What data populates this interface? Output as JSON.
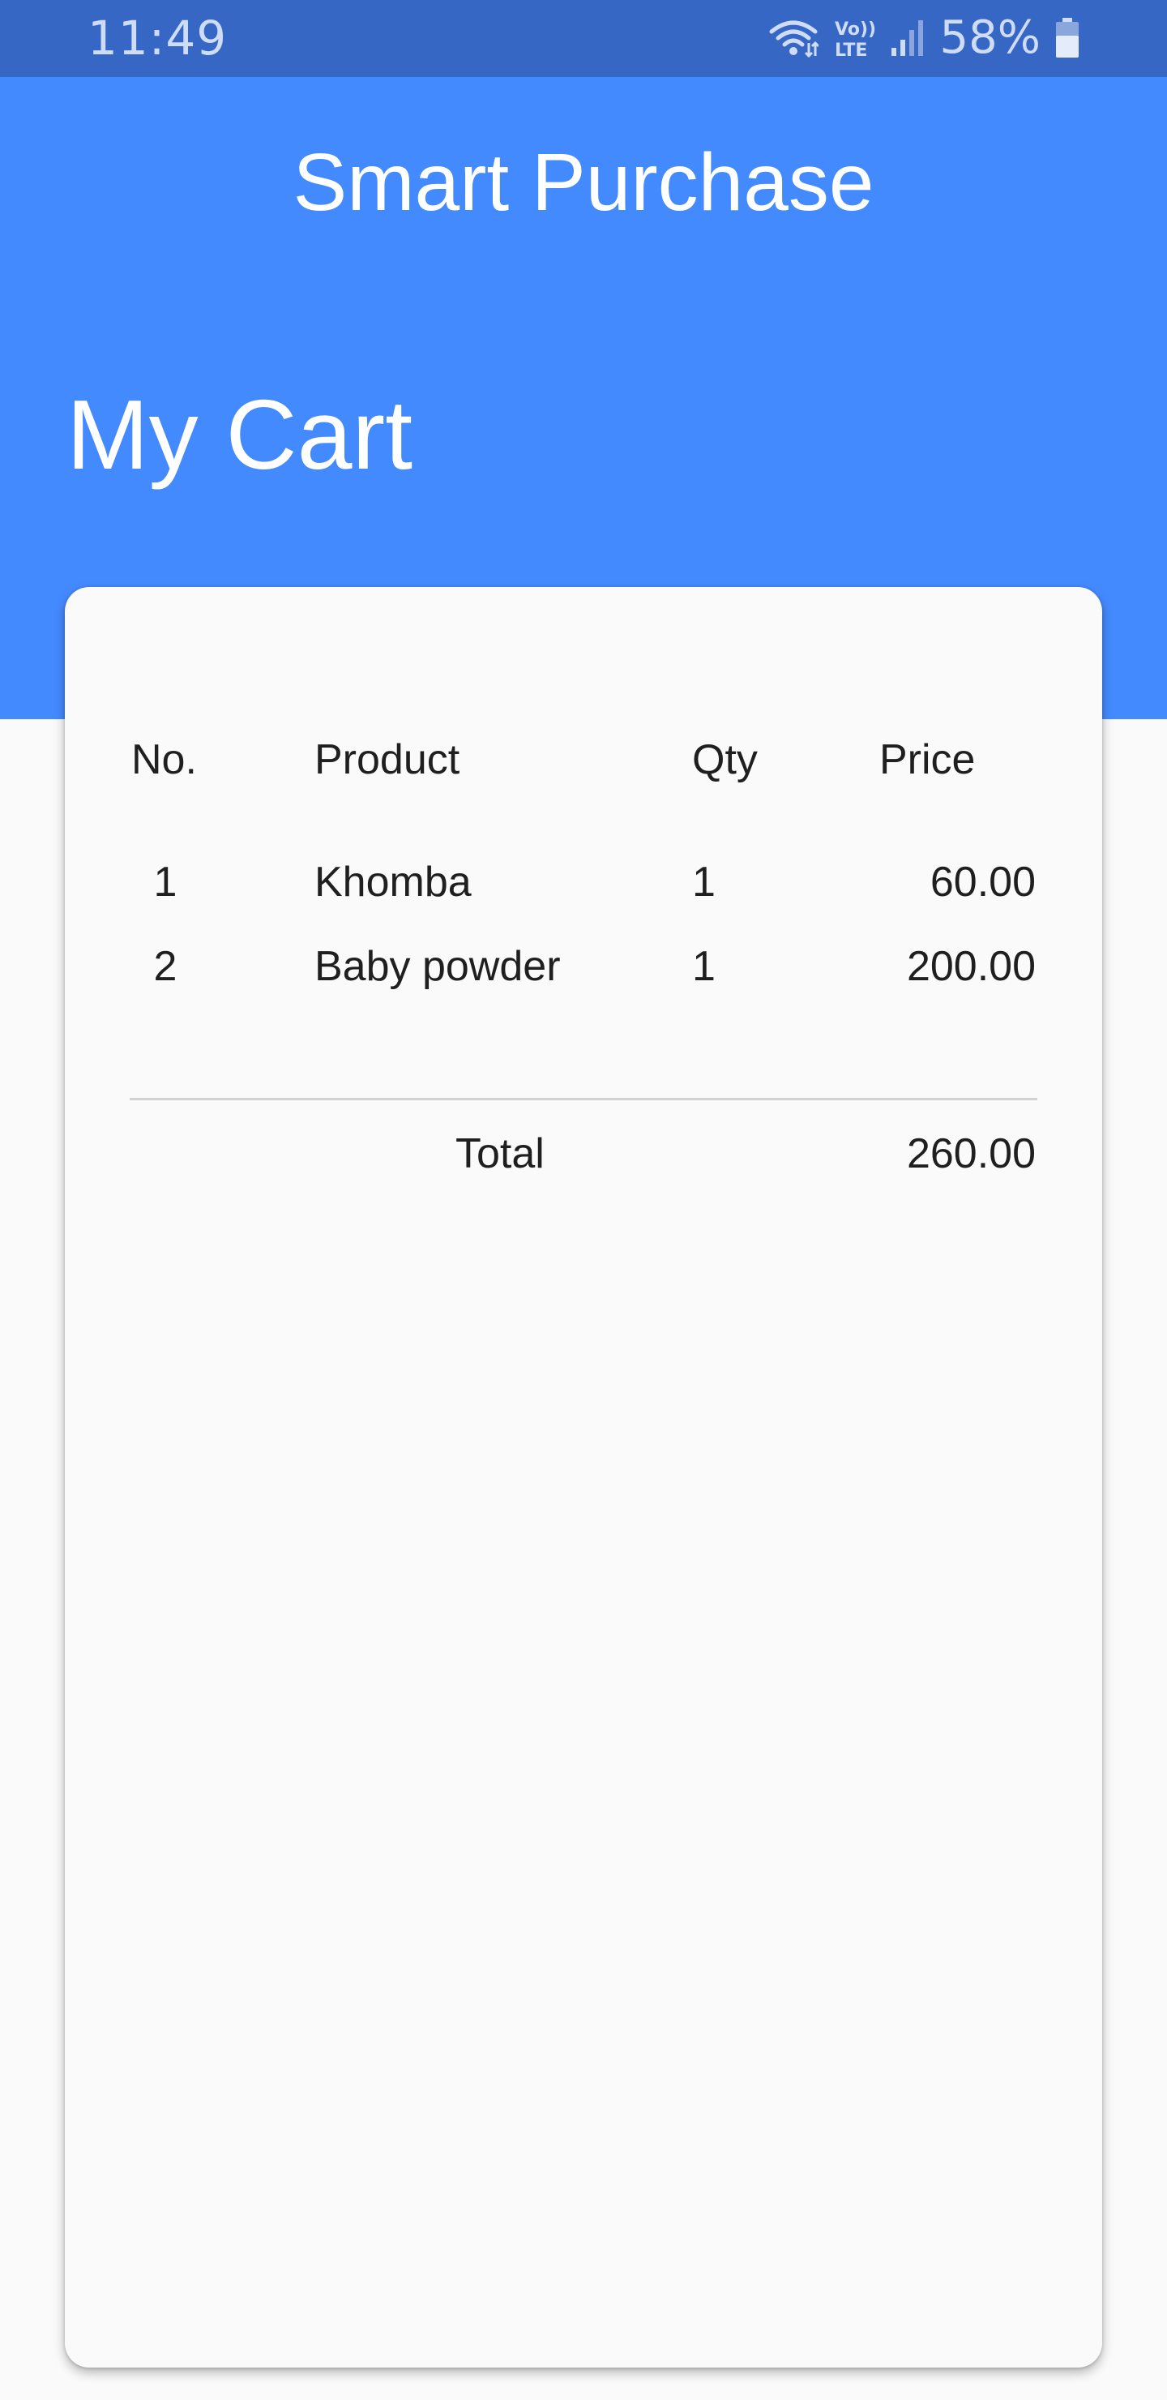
{
  "status_bar": {
    "time": "11:49",
    "network_label": "Vo)) LTE",
    "battery_percent": "58%",
    "icons": [
      "wifi-icon",
      "volte-lte-icon",
      "signal-icon",
      "battery-icon"
    ]
  },
  "header": {
    "app_title": "Smart Purchase",
    "page_title": "My Cart"
  },
  "cart": {
    "columns": [
      "No.",
      "Product",
      "Qty",
      "Price"
    ],
    "rows": [
      {
        "no": "1",
        "product": "Khomba",
        "qty": "1",
        "price": "60.00"
      },
      {
        "no": "2",
        "product": "Baby powder",
        "qty": "1",
        "price": "200.00"
      }
    ],
    "total_label": "Total",
    "total_value": "260.00"
  },
  "colors": {
    "status_bar": "#3767c4",
    "header": "#448aff",
    "background": "#fafafa",
    "text": "#1f1f1f"
  }
}
